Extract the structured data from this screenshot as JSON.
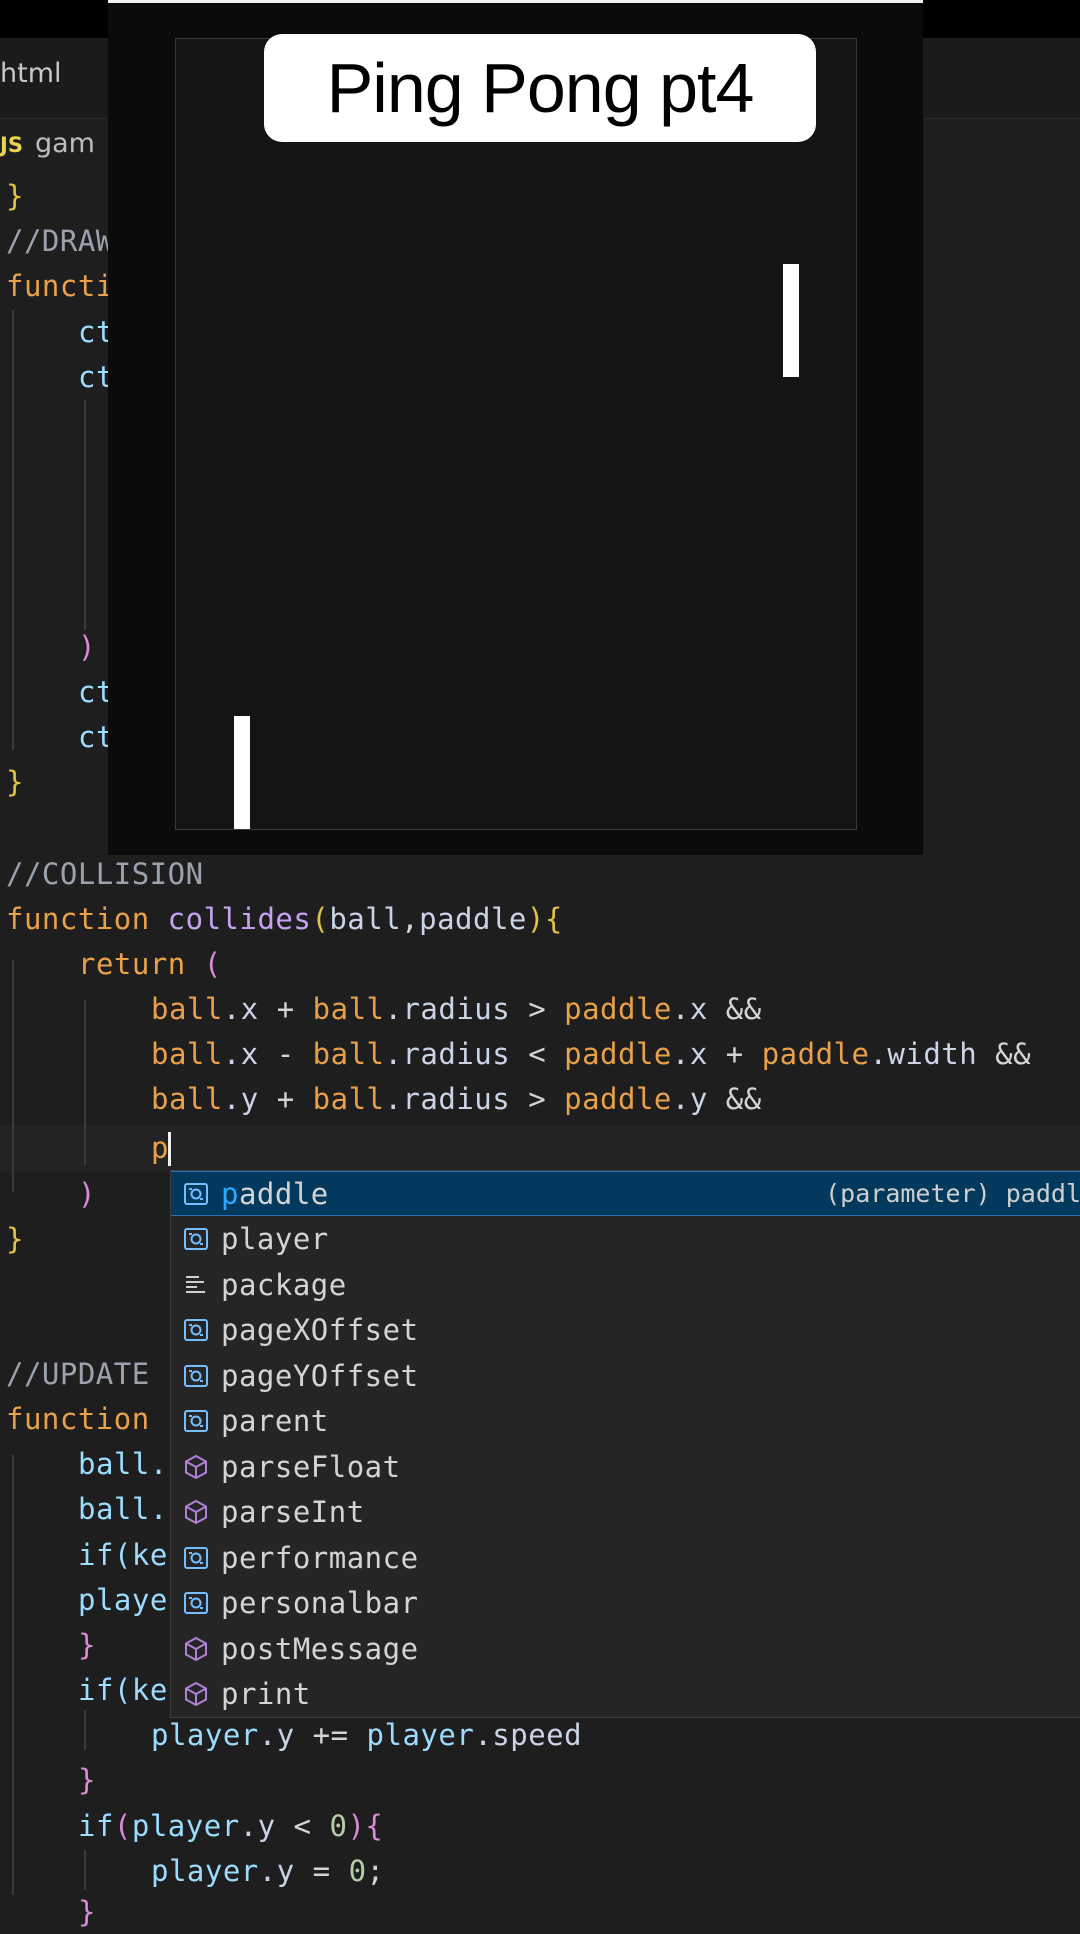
{
  "tabs": {
    "html_tab_label": "html",
    "js_badge": "JS",
    "js_tab_label": "gam"
  },
  "title_overlay": "Ping Pong pt4",
  "game": {
    "background": "#141414",
    "paddle_color": "#ffffff"
  },
  "code": {
    "line_closing_brace_1": "}",
    "draw_comment": "//DRAW",
    "draw_function_kw": "functi",
    "ctx_1": "ct",
    "ctx_2": "ct",
    "paren_close": ")",
    "ctx_3": "ct",
    "ctx_4": "ct",
    "closing_brace_2": "}",
    "collision_comment": "//COLLISION",
    "collides_kw": "function",
    "collides_name": "collides",
    "collides_params_open": "(",
    "collides_param_ball": "ball",
    "collides_comma": ",",
    "collides_param_paddle": "paddle",
    "collides_params_close": ")",
    "collides_brace": "{",
    "return_kw": "return",
    "return_paren": "(",
    "cond1": [
      "ball",
      ".x ",
      "+ ",
      "ball",
      ".radius ",
      "> ",
      "paddle",
      ".x ",
      "&&"
    ],
    "cond2": [
      "ball",
      ".x ",
      "- ",
      "ball",
      ".radius ",
      "< ",
      "paddle",
      ".x ",
      "+ ",
      "paddle",
      ".width ",
      "&&"
    ],
    "cond3": [
      "ball",
      ".y ",
      "+ ",
      "ball",
      ".radius ",
      "> ",
      "paddle",
      ".y ",
      "&&"
    ],
    "typed": "p",
    "return_close": ")",
    "closing_brace_3": "}",
    "update_comment": "//UPDATE",
    "update_kw": "function",
    "ball_line_1": "ball.",
    "ball_line_2": "ball.",
    "if_ke_1": "if(ke",
    "playe": "playe",
    "brace_close_small": "}",
    "if_ke_2": "if(ke",
    "player_y_plus": [
      "player",
      ".y ",
      "+= ",
      "player",
      ".speed"
    ],
    "brace_close_small_2": "}",
    "if_player_lt": [
      "if",
      "(",
      "player",
      ".y ",
      "< ",
      "0",
      ")",
      "{"
    ],
    "player_y_eq": [
      "player",
      ".y ",
      "= ",
      "0",
      ";"
    ],
    "brace_tail": "}"
  },
  "suggest": {
    "items": [
      {
        "icon": "variable-icon",
        "highlight": "p",
        "rest": "addle",
        "detail": "(parameter) paddl",
        "selected": true
      },
      {
        "icon": "variable-icon",
        "highlight": "",
        "rest": "player",
        "detail": "",
        "selected": false
      },
      {
        "icon": "module-icon",
        "highlight": "",
        "rest": "package",
        "detail": "",
        "selected": false
      },
      {
        "icon": "variable-icon",
        "highlight": "",
        "rest": "pageXOffset",
        "detail": "",
        "selected": false
      },
      {
        "icon": "variable-icon",
        "highlight": "",
        "rest": "pageYOffset",
        "detail": "",
        "selected": false
      },
      {
        "icon": "variable-icon",
        "highlight": "",
        "rest": "parent",
        "detail": "",
        "selected": false
      },
      {
        "icon": "method-icon",
        "highlight": "",
        "rest": "parseFloat",
        "detail": "",
        "selected": false
      },
      {
        "icon": "method-icon",
        "highlight": "",
        "rest": "parseInt",
        "detail": "",
        "selected": false
      },
      {
        "icon": "variable-icon",
        "highlight": "",
        "rest": "performance",
        "detail": "",
        "selected": false
      },
      {
        "icon": "variable-icon",
        "highlight": "",
        "rest": "personalbar",
        "detail": "",
        "selected": false
      },
      {
        "icon": "method-icon",
        "highlight": "",
        "rest": "postMessage",
        "detail": "",
        "selected": false
      },
      {
        "icon": "method-icon",
        "highlight": "",
        "rest": "print",
        "detail": "",
        "selected": false
      }
    ]
  }
}
